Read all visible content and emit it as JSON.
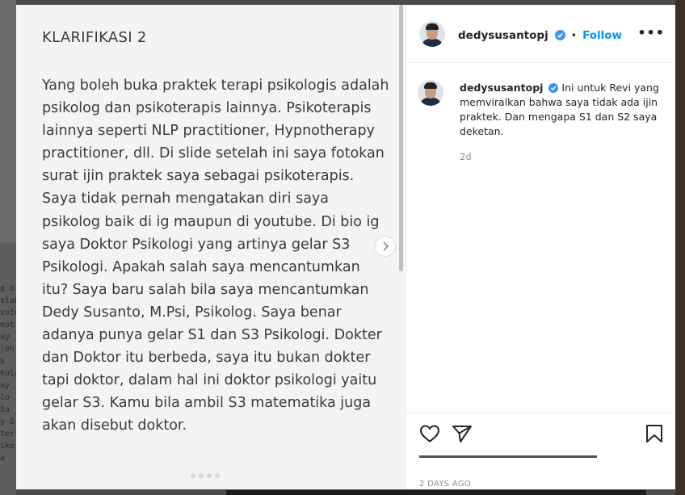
{
  "background": {
    "left_fragments": [
      "g b",
      "slah",
      "xote",
      "not",
      "ay",
      "leh",
      "s",
      "kolo",
      "ay",
      "lo",
      "Sa",
      "y S",
      "ter",
      "ike",
      "a"
    ]
  },
  "post": {
    "title": "KLARIFIKASI 2",
    "body": "Yang boleh buka praktek terapi psikologis adalah psikolog dan psikoterapis lainnya. Psikoterapis lainnya seperti NLP practitioner, Hypnotherapy practitioner, dll. Di slide setelah ini saya fotokan surat ijin praktek saya sebagai psikoterapis.\nSaya tidak pernah mengatakan diri saya psikolog baik di ig maupun di youtube. Di bio ig saya Doktor Psikologi yang artinya gelar S3 Psikologi. Apakah salah saya mencantumkan itu? Saya baru salah bila saya mencantumkan Dedy Susanto, M.Psi, Psikolog. Saya benar adanya punya gelar S1 dan S3 Psikologi. Dokter dan Doktor itu berbeda, saya itu bukan dokter tapi doktor, dalam hal ini doktor psikologi yaitu gelar S3. Kamu bila ambil S3 matematika juga akan disebut doktor.",
    "next_icon": "chevron-right-icon"
  },
  "header": {
    "username": "dedysusantopj",
    "separator": "•",
    "follow_label": "Follow",
    "more_icon": "more-options-icon",
    "verified_color": "#3897f0"
  },
  "caption": {
    "username": "dedysusantopj",
    "text": "Ini untuk Revi yang memviralkan bahwa saya tidak ada ijin praktek. Dan mengapa S1 dan S2 saya deketan.",
    "time": "2d"
  },
  "actions": {
    "like_icon": "heart-icon",
    "share_icon": "paper-plane-icon",
    "save_icon": "bookmark-icon",
    "timestamp": "2 DAYS AGO"
  },
  "colors": {
    "accent": "#0095f6",
    "text": "#262626",
    "muted": "#8e8e8e"
  }
}
